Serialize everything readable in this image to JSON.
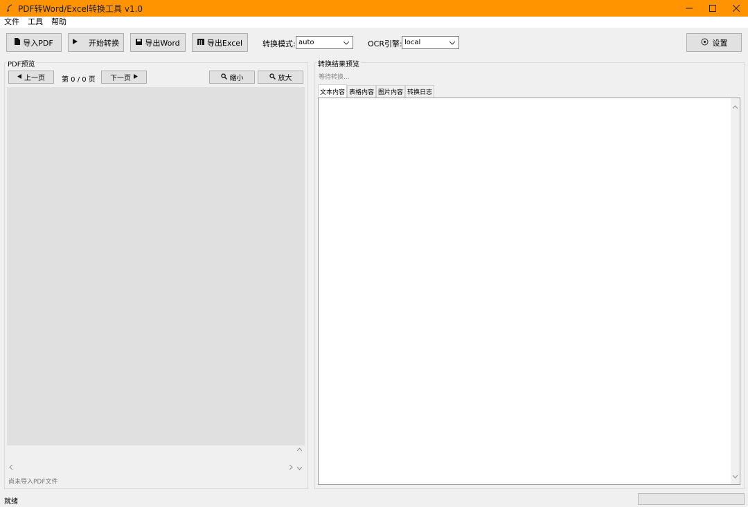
{
  "window": {
    "title": "PDF转Word/Excel转换工具 v1.0",
    "title_bar_color": "#ff9300",
    "controls": [
      "minimize",
      "maximize",
      "close"
    ]
  },
  "menu": [
    "文件",
    "工具",
    "帮助"
  ],
  "toolbar": {
    "import_label": "导入PDF",
    "start_label": "开始转换",
    "export_word_label": "导出Word",
    "export_excel_label": "导出Excel",
    "mode_label": "转换模式:",
    "mode_value": "auto",
    "ocr_label": "OCR引擎:",
    "ocr_value": "local",
    "settings_label": "设置"
  },
  "left_pane": {
    "group_title": "PDF预览",
    "prev_label": "上一页",
    "page_indicator": "第 0 / 0 页",
    "next_label": "下一页",
    "zoom_out_label": "缩小",
    "zoom_in_label": "放大",
    "status": "尚未导入PDF文件"
  },
  "right_pane": {
    "group_title": "转换结果预览",
    "waiting": "等待转换...",
    "tabs": [
      {
        "label": "文本内容",
        "active": true
      },
      {
        "label": "表格内容",
        "active": false
      },
      {
        "label": "图片内容",
        "active": false
      },
      {
        "label": "转换日志",
        "active": false
      }
    ]
  },
  "statusbar": {
    "text": "就绪",
    "progress": 0
  }
}
